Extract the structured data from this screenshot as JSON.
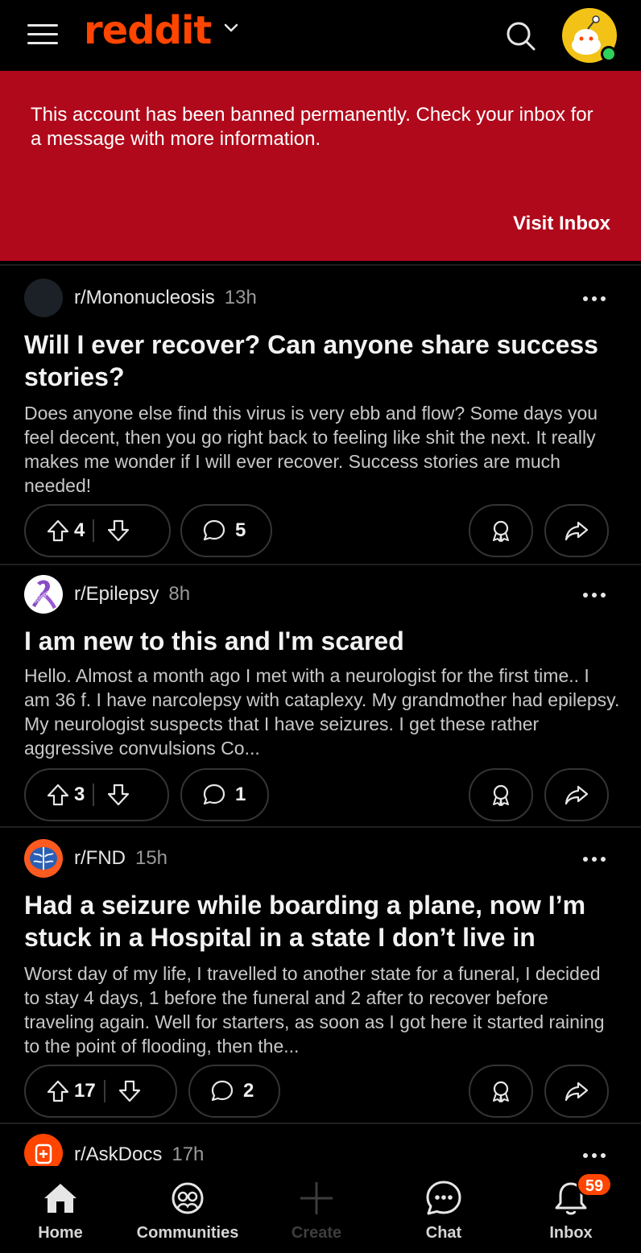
{
  "header": {
    "logo_text": "reddit",
    "brand_color": "#ff4500",
    "icons": [
      "menu-icon",
      "chevron-down-icon",
      "search-icon",
      "avatar"
    ]
  },
  "banner": {
    "message": "This account has been banned permanently. Check your inbox for a message with more information.",
    "link": "Visit Inbox",
    "color": "#b0091b"
  },
  "posts": [
    {
      "subreddit": "r/Mononucleosis",
      "time": "13h",
      "title": "Will I ever recover? Can anyone share success stories?",
      "body": "Does anyone else find this virus is very ebb and flow? Some days you feel decent, then you go right back to feeling like shit the next. It really makes me wonder if I will ever recover. Success stories are much needed!",
      "votes": "4",
      "comments": "5"
    },
    {
      "subreddit": "r/Epilepsy",
      "time": "8h",
      "avatar_text": "epilepsy",
      "title": "I am new to this and I'm scared",
      "body": "Hello. Almost a month ago I met with a neurologist for the first time.. I am 36 f. I have narcolepsy with cataplexy. My grandmother had epilepsy. My neurologist suspects that I have seizures. I get these rather aggressive convulsions Co...",
      "votes": "3",
      "comments": "1"
    },
    {
      "subreddit": "r/FND",
      "time": "15h",
      "title": "Had a seizure while boarding a plane, now I’m stuck in a Hospital in a state I don’t live in",
      "body": "Worst day of my life, I travelled to another state for a funeral, I decided to stay 4 days, 1 before the funeral and 2 after to recover before traveling again. Well for starters, as soon as I got here it started raining to the point of flooding, then the...",
      "votes": "17",
      "comments": "2"
    },
    {
      "subreddit": "r/AskDocs",
      "time": "17h"
    }
  ],
  "nav": {
    "home": "Home",
    "communities": "Communities",
    "create": "Create",
    "chat": "Chat",
    "inbox": "Inbox",
    "inbox_badge": "59"
  }
}
